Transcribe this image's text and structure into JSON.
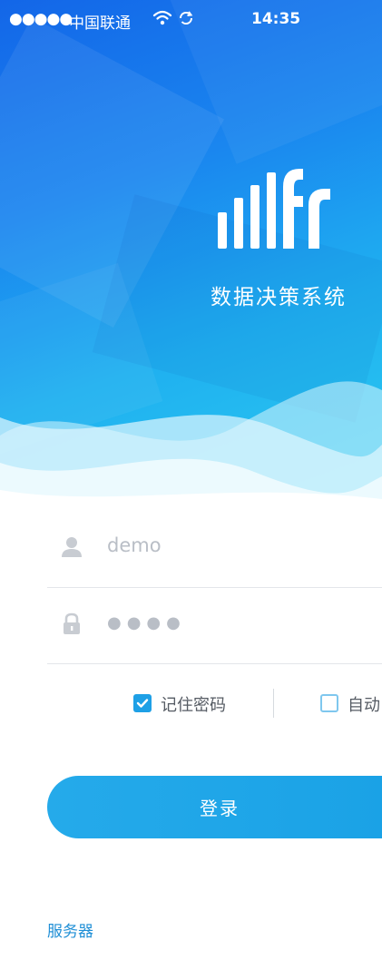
{
  "statusbar": {
    "signal_dots": "●●●●●",
    "carrier": "中国联通",
    "time": "14:35"
  },
  "app": {
    "title": "数据决策系统"
  },
  "login": {
    "username_value": "demo",
    "password_mask": "●●●●",
    "remember_label": "记住密码",
    "remember_checked": true,
    "auto_login_label": "自动",
    "auto_login_checked": false,
    "submit_label": "登录"
  },
  "footer": {
    "server_label": "服务器"
  },
  "colors": {
    "accent": "#1ea0e6",
    "hero_top": "#1366e8",
    "hero_bottom": "#2ccbef"
  },
  "icons": [
    "user-icon",
    "lock-icon",
    "checkbox-checked-icon",
    "checkbox-unchecked-icon",
    "wifi-icon",
    "sync-icon",
    "app-logo"
  ]
}
